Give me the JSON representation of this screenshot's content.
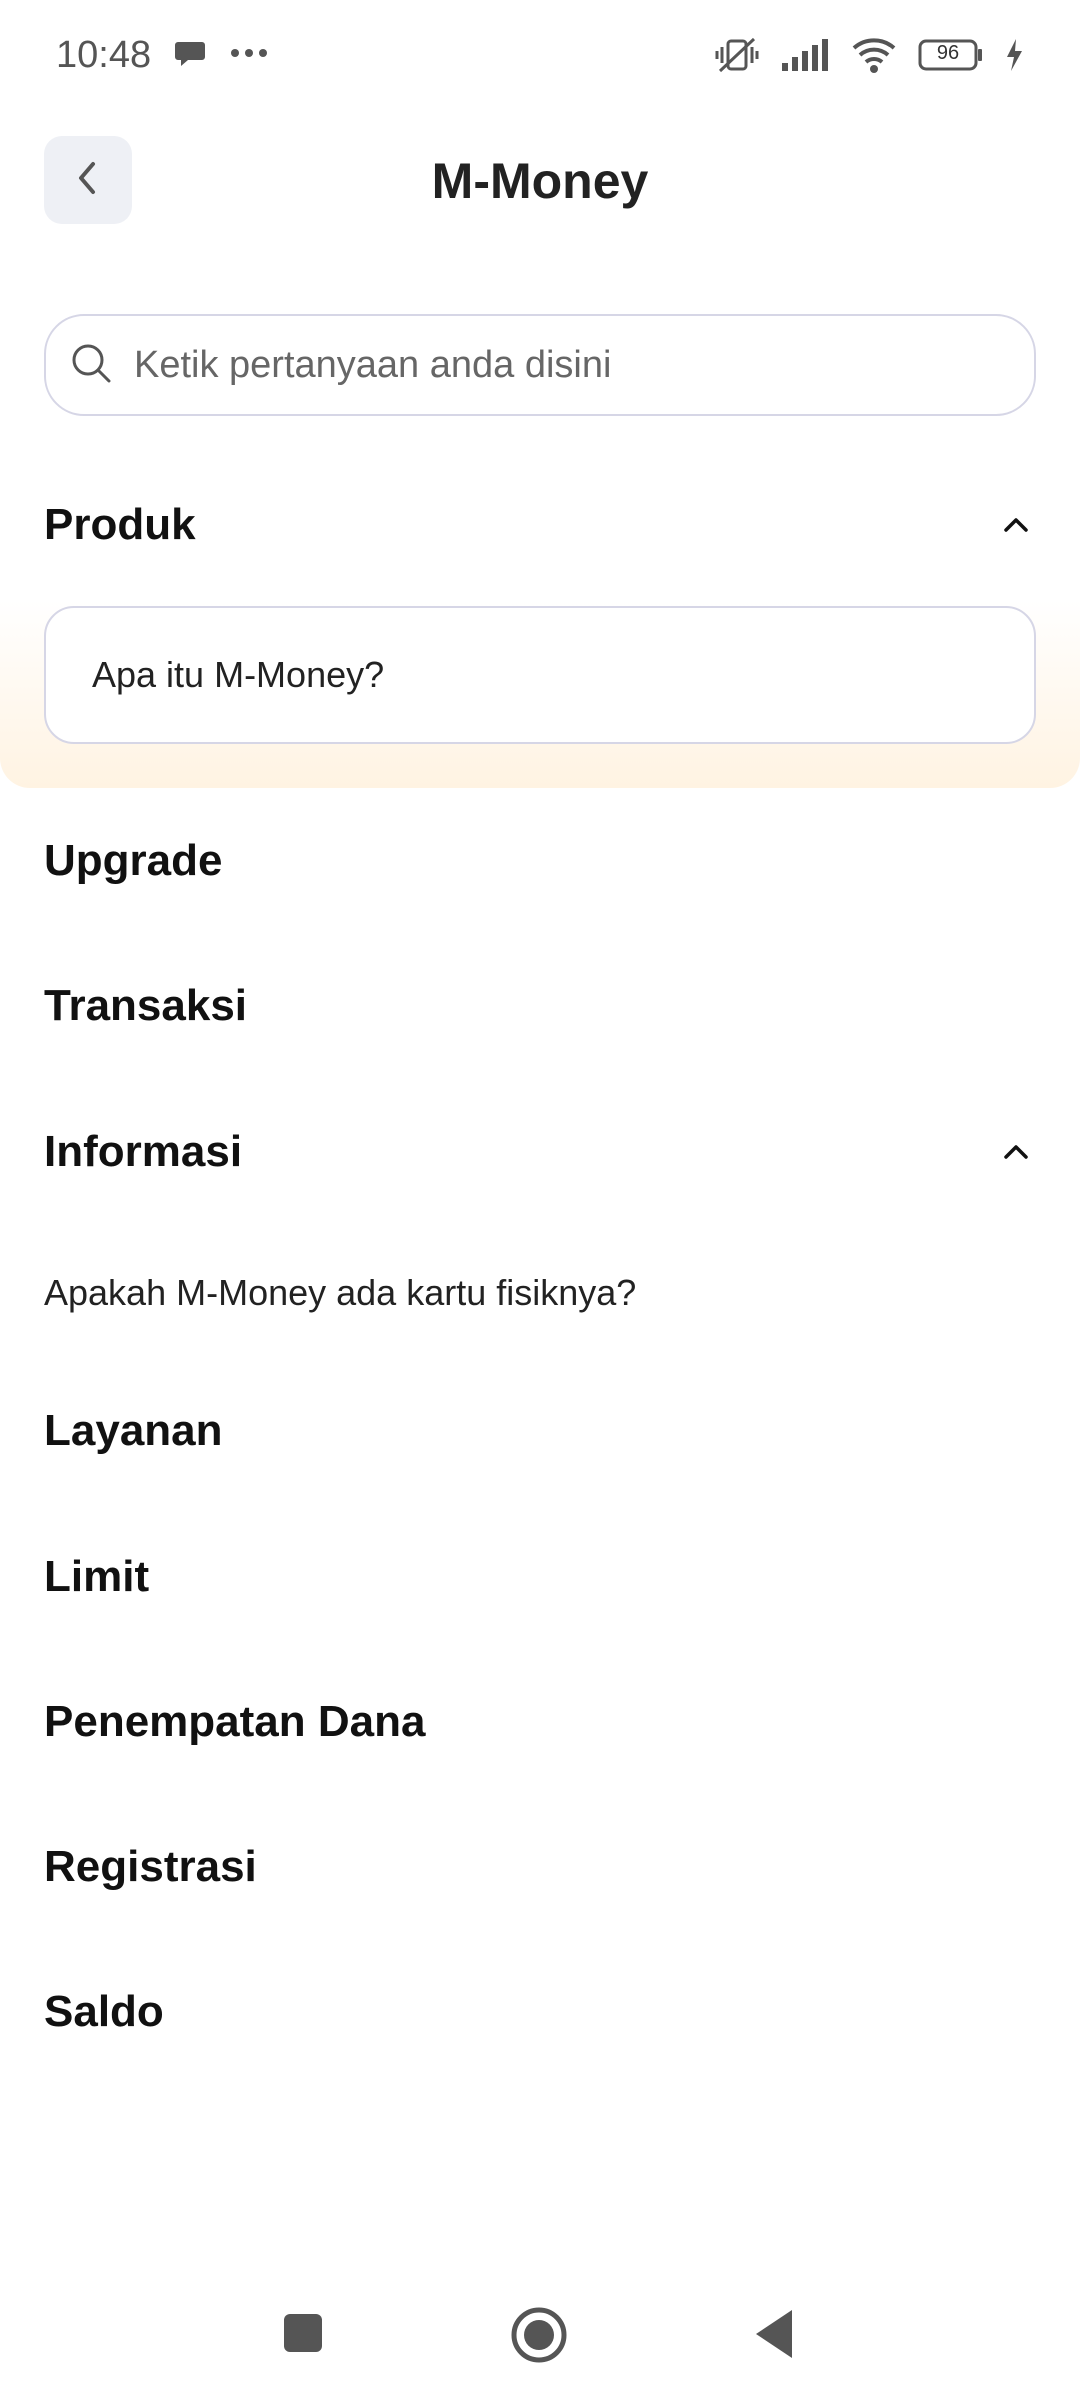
{
  "status_bar": {
    "time": "10:48",
    "icons": [
      "chat-bubble-icon",
      "more-dots-icon",
      "vibrate-off-icon",
      "signal-icon",
      "wifi-icon",
      "battery-icon",
      "charging-icon"
    ],
    "battery_level": "96"
  },
  "header": {
    "title": "M-Money",
    "back_icon": "chevron-left-icon"
  },
  "search": {
    "placeholder": "Ketik pertanyaan anda disini",
    "icon": "search-icon"
  },
  "sections": {
    "produk": {
      "label": "Produk",
      "expanded": true,
      "items": [
        "Apa itu M-Money?"
      ]
    },
    "upgrade": {
      "label": "Upgrade"
    },
    "transaksi": {
      "label": "Transaksi"
    },
    "informasi": {
      "label": "Informasi",
      "expanded": true,
      "items": [
        "Apakah M-Money ada kartu fisiknya?"
      ]
    },
    "layanan": {
      "label": "Layanan"
    },
    "limit": {
      "label": "Limit"
    },
    "penempatan_dana": {
      "label": "Penempatan Dana"
    },
    "registrasi": {
      "label": "Registrasi"
    },
    "saldo": {
      "label": "Saldo"
    }
  },
  "colors": {
    "highlight": "#fff3e2",
    "border": "#d6d6e6",
    "back_button_bg": "#eef0f5"
  },
  "nav_bar": {
    "buttons": [
      "recents-square-icon",
      "home-circle-icon",
      "back-triangle-icon"
    ]
  }
}
